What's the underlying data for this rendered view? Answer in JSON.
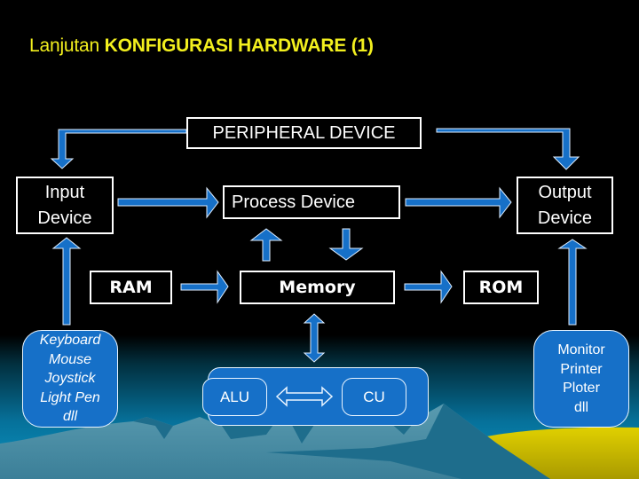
{
  "slide": {
    "title_prefix": "Lanjutan ",
    "title_main": "KONFIGURASI HARDWARE (1)"
  },
  "diagram": {
    "peripheral": "PERIPHERAL DEVICE",
    "input_device": [
      "Input",
      "Device"
    ],
    "process_device": "Process Device",
    "output_device": [
      "Output",
      "Device"
    ],
    "ram": "RAM",
    "memory": "Memory",
    "rom": "ROM",
    "input_examples": [
      "Keyboard",
      "Mouse",
      "Joystick",
      "Light Pen",
      "dll"
    ],
    "output_examples": [
      "Monitor",
      "Printer",
      "Ploter",
      "dll"
    ],
    "cpu": {
      "alu": "ALU",
      "cu": "CU"
    }
  },
  "colors": {
    "title": "#f2ef1e",
    "arrow": "#1670c8",
    "box_border": "#ffffff",
    "rounded_box_fill": "#1670c8",
    "sky_top": "#000000",
    "sky_bottom": "#0a8fbf",
    "mountain": "#4e8fa3",
    "mountain_shadow": "#1d6a89",
    "sand": "#d9c800"
  }
}
